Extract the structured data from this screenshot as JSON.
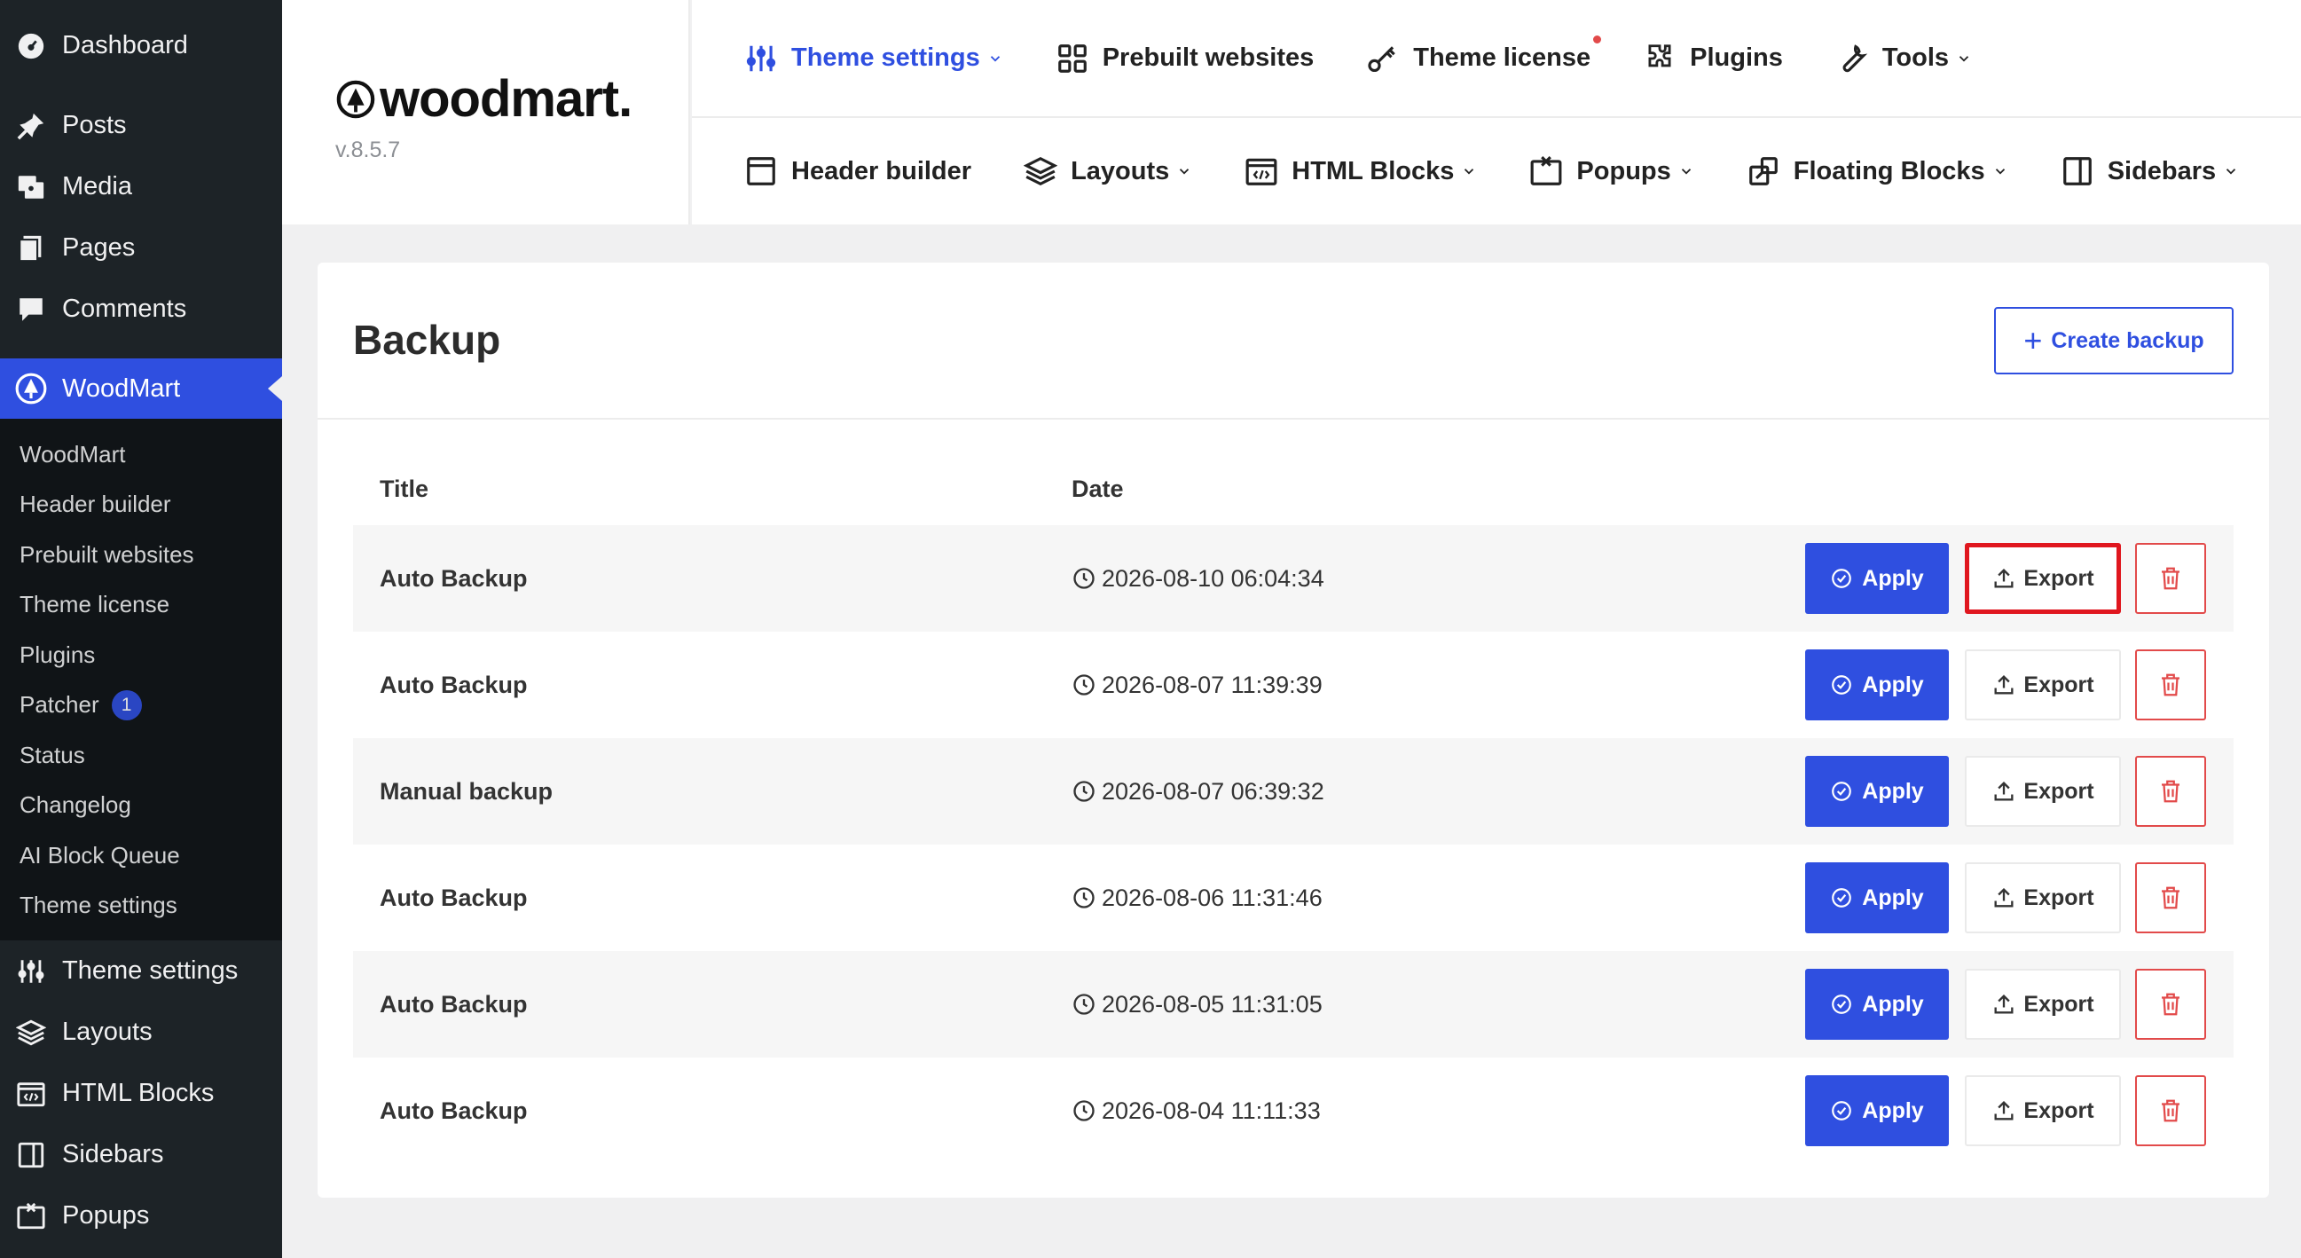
{
  "wp_menu": {
    "items": [
      {
        "label": "Dashboard",
        "icon": "dashboard-icon"
      },
      {
        "label": "Posts",
        "icon": "pin-icon"
      },
      {
        "label": "Media",
        "icon": "media-icon"
      },
      {
        "label": "Pages",
        "icon": "pages-icon"
      },
      {
        "label": "Comments",
        "icon": "comment-icon"
      }
    ],
    "active": {
      "label": "WoodMart",
      "icon": "woodmart-icon"
    },
    "submenu": [
      "WoodMart",
      "Header builder",
      "Prebuilt websites",
      "Theme license",
      "Plugins",
      "Patcher",
      "Status",
      "Changelog",
      "AI Block Queue",
      "Theme settings"
    ],
    "patcher_badge": "1",
    "bottom_items": [
      {
        "label": "Theme settings",
        "icon": "sliders-icon"
      },
      {
        "label": "Layouts",
        "icon": "layers-icon"
      },
      {
        "label": "HTML Blocks",
        "icon": "code-block-icon"
      },
      {
        "label": "Sidebars",
        "icon": "sidebar-icon"
      },
      {
        "label": "Popups",
        "icon": "popup-icon"
      }
    ]
  },
  "brand": {
    "logo_text": "woodmart.",
    "version": "v.8.5.7"
  },
  "top_nav": {
    "row1": [
      {
        "label": "Theme settings",
        "icon": "sliders-icon",
        "dropdown": true,
        "active": true
      },
      {
        "label": "Prebuilt websites",
        "icon": "grid-icon",
        "dropdown": false
      },
      {
        "label": "Theme license",
        "icon": "key-icon",
        "dropdown": false,
        "notification": true
      },
      {
        "label": "Plugins",
        "icon": "puzzle-icon",
        "dropdown": false
      },
      {
        "label": "Tools",
        "icon": "wrench-icon",
        "dropdown": true
      }
    ],
    "row2": [
      {
        "label": "Header builder",
        "icon": "window-icon",
        "dropdown": false
      },
      {
        "label": "Layouts",
        "icon": "layers-icon",
        "dropdown": true
      },
      {
        "label": "HTML Blocks",
        "icon": "code-block-icon",
        "dropdown": true
      },
      {
        "label": "Popups",
        "icon": "popup-icon",
        "dropdown": true
      },
      {
        "label": "Floating Blocks",
        "icon": "floating-icon",
        "dropdown": true
      },
      {
        "label": "Sidebars",
        "icon": "sidebar-icon",
        "dropdown": true
      }
    ]
  },
  "backup": {
    "title": "Backup",
    "create_label": "Create backup",
    "columns": {
      "title": "Title",
      "date": "Date"
    },
    "apply_label": "Apply",
    "export_label": "Export",
    "rows": [
      {
        "title": "Auto Backup",
        "date": "2026-08-10 06:04:34"
      },
      {
        "title": "Auto Backup",
        "date": "2026-08-07 11:39:39"
      },
      {
        "title": "Manual backup",
        "date": "2026-08-07 06:39:32"
      },
      {
        "title": "Auto Backup",
        "date": "2026-08-06 11:31:46"
      },
      {
        "title": "Auto Backup",
        "date": "2026-08-05 11:31:05"
      },
      {
        "title": "Auto Backup",
        "date": "2026-08-04 11:11:33"
      }
    ],
    "highlighted_export_row": 0
  },
  "colors": {
    "accent": "#2f4fe0",
    "danger": "#e24a4a",
    "highlight": "#e0171f",
    "sidebar_bg": "#1d2327"
  }
}
